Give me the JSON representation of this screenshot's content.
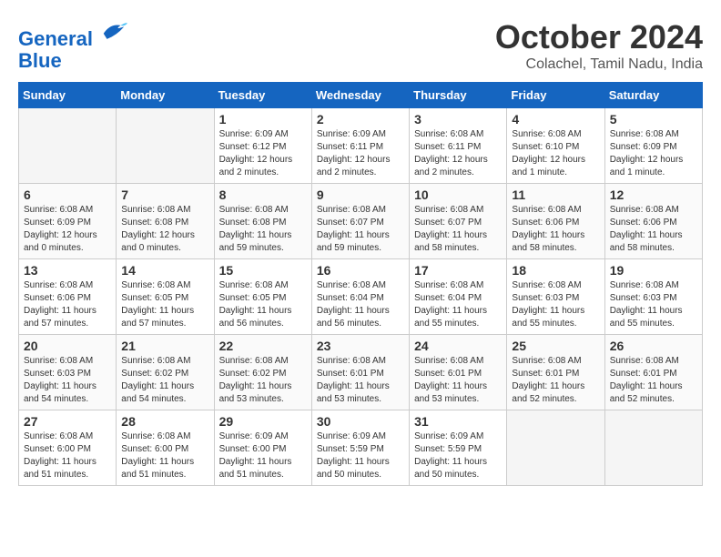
{
  "logo": {
    "line1": "General",
    "line2": "Blue"
  },
  "title": "October 2024",
  "location": "Colachel, Tamil Nadu, India",
  "days_of_week": [
    "Sunday",
    "Monday",
    "Tuesday",
    "Wednesday",
    "Thursday",
    "Friday",
    "Saturday"
  ],
  "weeks": [
    [
      {
        "day": "",
        "info": ""
      },
      {
        "day": "",
        "info": ""
      },
      {
        "day": "1",
        "info": "Sunrise: 6:09 AM\nSunset: 6:12 PM\nDaylight: 12 hours\nand 2 minutes."
      },
      {
        "day": "2",
        "info": "Sunrise: 6:09 AM\nSunset: 6:11 PM\nDaylight: 12 hours\nand 2 minutes."
      },
      {
        "day": "3",
        "info": "Sunrise: 6:08 AM\nSunset: 6:11 PM\nDaylight: 12 hours\nand 2 minutes."
      },
      {
        "day": "4",
        "info": "Sunrise: 6:08 AM\nSunset: 6:10 PM\nDaylight: 12 hours\nand 1 minute."
      },
      {
        "day": "5",
        "info": "Sunrise: 6:08 AM\nSunset: 6:09 PM\nDaylight: 12 hours\nand 1 minute."
      }
    ],
    [
      {
        "day": "6",
        "info": "Sunrise: 6:08 AM\nSunset: 6:09 PM\nDaylight: 12 hours\nand 0 minutes."
      },
      {
        "day": "7",
        "info": "Sunrise: 6:08 AM\nSunset: 6:08 PM\nDaylight: 12 hours\nand 0 minutes."
      },
      {
        "day": "8",
        "info": "Sunrise: 6:08 AM\nSunset: 6:08 PM\nDaylight: 11 hours\nand 59 minutes."
      },
      {
        "day": "9",
        "info": "Sunrise: 6:08 AM\nSunset: 6:07 PM\nDaylight: 11 hours\nand 59 minutes."
      },
      {
        "day": "10",
        "info": "Sunrise: 6:08 AM\nSunset: 6:07 PM\nDaylight: 11 hours\nand 58 minutes."
      },
      {
        "day": "11",
        "info": "Sunrise: 6:08 AM\nSunset: 6:06 PM\nDaylight: 11 hours\nand 58 minutes."
      },
      {
        "day": "12",
        "info": "Sunrise: 6:08 AM\nSunset: 6:06 PM\nDaylight: 11 hours\nand 58 minutes."
      }
    ],
    [
      {
        "day": "13",
        "info": "Sunrise: 6:08 AM\nSunset: 6:06 PM\nDaylight: 11 hours\nand 57 minutes."
      },
      {
        "day": "14",
        "info": "Sunrise: 6:08 AM\nSunset: 6:05 PM\nDaylight: 11 hours\nand 57 minutes."
      },
      {
        "day": "15",
        "info": "Sunrise: 6:08 AM\nSunset: 6:05 PM\nDaylight: 11 hours\nand 56 minutes."
      },
      {
        "day": "16",
        "info": "Sunrise: 6:08 AM\nSunset: 6:04 PM\nDaylight: 11 hours\nand 56 minutes."
      },
      {
        "day": "17",
        "info": "Sunrise: 6:08 AM\nSunset: 6:04 PM\nDaylight: 11 hours\nand 55 minutes."
      },
      {
        "day": "18",
        "info": "Sunrise: 6:08 AM\nSunset: 6:03 PM\nDaylight: 11 hours\nand 55 minutes."
      },
      {
        "day": "19",
        "info": "Sunrise: 6:08 AM\nSunset: 6:03 PM\nDaylight: 11 hours\nand 55 minutes."
      }
    ],
    [
      {
        "day": "20",
        "info": "Sunrise: 6:08 AM\nSunset: 6:03 PM\nDaylight: 11 hours\nand 54 minutes."
      },
      {
        "day": "21",
        "info": "Sunrise: 6:08 AM\nSunset: 6:02 PM\nDaylight: 11 hours\nand 54 minutes."
      },
      {
        "day": "22",
        "info": "Sunrise: 6:08 AM\nSunset: 6:02 PM\nDaylight: 11 hours\nand 53 minutes."
      },
      {
        "day": "23",
        "info": "Sunrise: 6:08 AM\nSunset: 6:01 PM\nDaylight: 11 hours\nand 53 minutes."
      },
      {
        "day": "24",
        "info": "Sunrise: 6:08 AM\nSunset: 6:01 PM\nDaylight: 11 hours\nand 53 minutes."
      },
      {
        "day": "25",
        "info": "Sunrise: 6:08 AM\nSunset: 6:01 PM\nDaylight: 11 hours\nand 52 minutes."
      },
      {
        "day": "26",
        "info": "Sunrise: 6:08 AM\nSunset: 6:01 PM\nDaylight: 11 hours\nand 52 minutes."
      }
    ],
    [
      {
        "day": "27",
        "info": "Sunrise: 6:08 AM\nSunset: 6:00 PM\nDaylight: 11 hours\nand 51 minutes."
      },
      {
        "day": "28",
        "info": "Sunrise: 6:08 AM\nSunset: 6:00 PM\nDaylight: 11 hours\nand 51 minutes."
      },
      {
        "day": "29",
        "info": "Sunrise: 6:09 AM\nSunset: 6:00 PM\nDaylight: 11 hours\nand 51 minutes."
      },
      {
        "day": "30",
        "info": "Sunrise: 6:09 AM\nSunset: 5:59 PM\nDaylight: 11 hours\nand 50 minutes."
      },
      {
        "day": "31",
        "info": "Sunrise: 6:09 AM\nSunset: 5:59 PM\nDaylight: 11 hours\nand 50 minutes."
      },
      {
        "day": "",
        "info": ""
      },
      {
        "day": "",
        "info": ""
      }
    ]
  ]
}
